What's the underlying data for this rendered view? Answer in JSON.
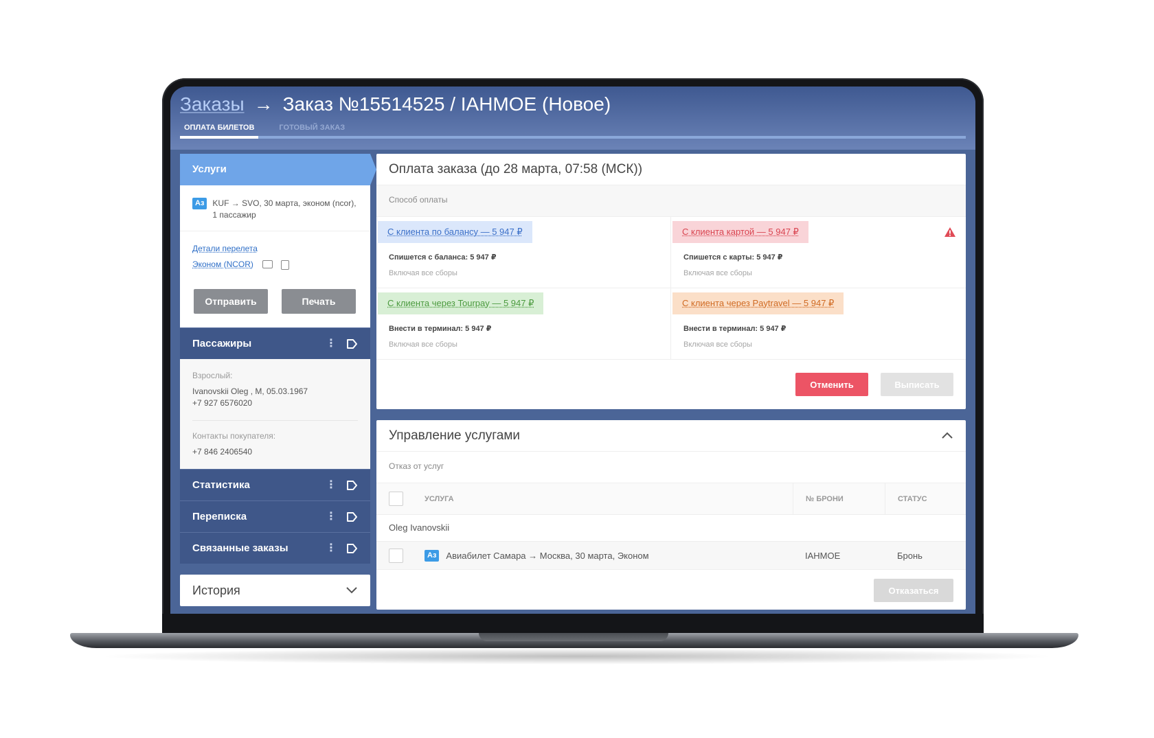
{
  "header": {
    "crumb_link": "Заказы",
    "arrow": "→",
    "title": "Заказ №15514525 / IAHMOE (Новое)",
    "tabs": [
      {
        "label": "ОПЛАТА БИЛЕТОВ",
        "active": true
      },
      {
        "label": "ГОТОВЫЙ ЗАКАЗ",
        "active": false
      }
    ]
  },
  "sidebar": {
    "services": {
      "title": "Услуги",
      "airline_badge": "Аз",
      "route": "KUF → SVO, 30 марта, эконом (ncor), 1 пассажир",
      "flight_details_link": "Детали перелета",
      "fare_link": "Эконом (NCOR)",
      "send_button": "Отправить",
      "print_button": "Печать"
    },
    "passengers": {
      "title": "Пассажиры",
      "adult_label": "Взрослый:",
      "adult_value": "Ivanovskii Oleg , M, 05.03.1967",
      "adult_phone": "+7 927 6576020",
      "contacts_label": "Контакты покупателя:",
      "contacts_value": "+7 846 2406540"
    },
    "statistics": {
      "title": "Статистика"
    },
    "correspondence": {
      "title": "Переписка"
    },
    "related_orders": {
      "title": "Связанные заказы"
    },
    "history": {
      "title": "История"
    }
  },
  "payment": {
    "title": "Оплата заказа (до 28 марта, 07:58 (МСК))",
    "method_label": "Способ оплаты",
    "options": [
      {
        "label": "С клиента по балансу — 5 947 ₽",
        "line1": "Спишется с баланса: 5 947 ₽",
        "line2": "Включая все сборы"
      },
      {
        "label": "С клиента картой — 5 947 ₽",
        "line1": "Спишется с карты: 5 947 ₽",
        "line2": "Включая все сборы"
      },
      {
        "label": "С клиента через Tourpay — 5 947 ₽",
        "line1": "Внести в терминал: 5 947 ₽",
        "line2": "Включая все сборы"
      },
      {
        "label": "С клиента через Paytravel — 5 947 ₽",
        "line1": "Внести в терминал: 5 947 ₽",
        "line2": "Включая все сборы"
      }
    ],
    "cancel_button": "Отменить",
    "issue_button": "Выписать"
  },
  "services_mgmt": {
    "title": "Управление услугами",
    "subtitle": "Отказ от услуг",
    "columns": {
      "service": "УСЛУГА",
      "pnr": "№ БРОНИ",
      "status": "СТАТУС"
    },
    "group": "Oleg Ivanovskii",
    "rows": [
      {
        "badge": "Аз",
        "service": "Авиабилет Самара → Москва, 30 марта, Эконом",
        "pnr": "IAHMOE",
        "status": "Бронь"
      }
    ],
    "refuse_button": "Отказаться"
  },
  "colors": {
    "accent": "#6fa5e8",
    "header_dark": "#3f5991",
    "danger": "#ec5465",
    "badge": "#3c9be6"
  }
}
